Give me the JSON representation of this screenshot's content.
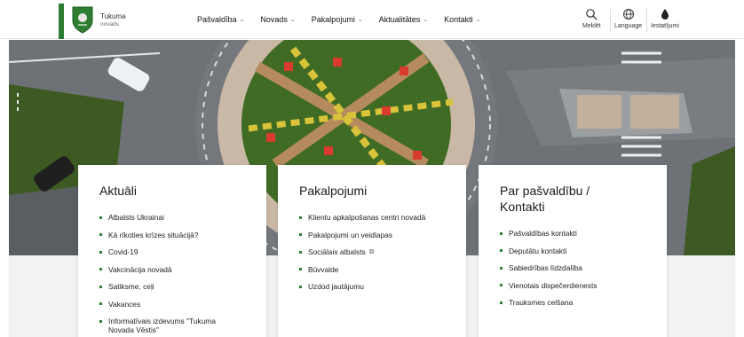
{
  "header": {
    "brand_name": "Tukuma",
    "brand_sub": "novads",
    "nav": [
      {
        "label": "Pašvaldība"
      },
      {
        "label": "Novads"
      },
      {
        "label": "Pakalpojumi"
      },
      {
        "label": "Aktualitātes"
      },
      {
        "label": "Kontakti"
      }
    ],
    "tools": {
      "search_label": "Meklēt",
      "language_label": "Language",
      "settings_label": "Iestatījumi"
    }
  },
  "colors": {
    "accent_green": "#2e7d32",
    "asphalt": "#6f7377",
    "grass": "#3d5a23"
  },
  "cards": {
    "aktuali": {
      "title": "Aktuāli",
      "items": [
        "Atbalsts Ukrainai",
        "Kā rīkoties krīzes situācijā?",
        "Covid-19",
        "Vakcinācija novadā",
        "Satiksme, ceļi",
        "Vakances",
        "Informatīvais izdevums \"Tukuma Novada Vēstis\""
      ]
    },
    "pakalpojumi": {
      "title": "Pakalpojumi",
      "items": [
        "Klientu apkalpošanas centri novadā",
        "Pakalpojumi un veidlapas",
        "Sociālais atbalsts",
        "Būvvalde",
        "Uzdod jautājumu"
      ]
    },
    "kontakti": {
      "title": "Par pašvaldību / Kontakti",
      "items": [
        "Pašvaldības kontakti",
        "Deputātu kontakti",
        "Sabiedrības līdzdalība",
        "Vienotais dispečerdienests",
        "Trauksmes celšana"
      ]
    }
  }
}
